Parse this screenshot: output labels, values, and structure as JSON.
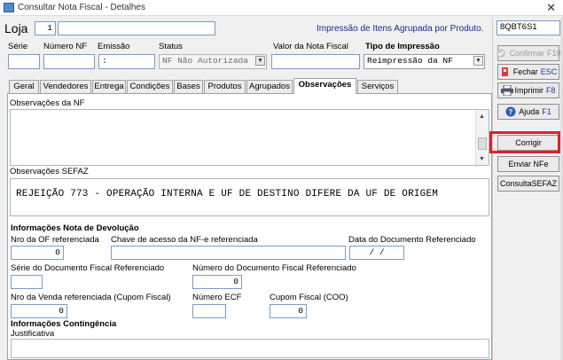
{
  "window": {
    "title": "Consultar Nota Fiscal - Detalhes",
    "close_glyph": "✕"
  },
  "header": {
    "loja_label": "Loja",
    "loja_value": "1",
    "loja_name": "",
    "impressao_text": "Impressão de Itens Agrupada por Produto.",
    "code_value": "8QBT6S1"
  },
  "fields": {
    "serie_label": "Série",
    "numero_nf_label": "Número NF",
    "emissao_label": "Emissão",
    "emissao_value": ":",
    "status_label": "Status",
    "status_value": "NF Não Autorizada",
    "valor_label": "Valor da Nota Fiscal",
    "valor_value": "",
    "tipo_impressao_label": "Tipo de Impressão",
    "tipo_impressao_value": "Reimpressão da NF"
  },
  "tabs": [
    "Geral",
    "Vendedores",
    "Entrega",
    "Condições",
    "Bases",
    "Produtos",
    "Agrupados",
    "Observações",
    "Serviços"
  ],
  "active_tab": "Observações",
  "observacoes": {
    "obs_nf_label": "Observações da NF",
    "obs_sefaz_label": "Observações SEFAZ",
    "obs_sefaz_text": "REJEIÇÃO 773 - OPERAÇÃO INTERNA E UF DE DESTINO DIFERE DA UF DE ORIGEM"
  },
  "devolucao": {
    "section_title": "Informações Nota de Devolução",
    "nro_of_label": "Nro da OF referenciada",
    "nro_of_value": "0",
    "chave_label": "Chave de acesso da NF-e referenciada",
    "chave_value": "",
    "data_doc_label": "Data do Documento Referenciado",
    "data_doc_value": "/ /",
    "serie_doc_label": "Série do Documento Fiscal Referenciado",
    "numero_doc_label": "Número do Documento Fiscal Referenciado",
    "numero_doc_value": "0",
    "nro_venda_label": "Nro da Venda referenciada (Cupom Fiscal)",
    "nro_venda_value": "0",
    "numero_ecf_label": "Número ECF",
    "cupom_label": "Cupom Fiscal (COO)",
    "cupom_value": "0"
  },
  "contingencia": {
    "section_title": "Informações Contingência",
    "justificativa_label": "Justificativa"
  },
  "buttons": {
    "confirmar": {
      "label": "Confirmar",
      "key": "F10"
    },
    "fechar": {
      "label": "Fechar",
      "key": "ESC"
    },
    "imprimir": {
      "label": "Imprimir",
      "key": "F8"
    },
    "ajuda": {
      "label": "Ajuda",
      "key": "F1"
    },
    "corrigir": "Corrigir",
    "enviar_nfe": "Enviar NFe",
    "consulta_sefaz": "ConsultaSEFAZ"
  },
  "colors": {
    "highlight": "#e0202a",
    "accent_text": "#1e2a8c",
    "input_border": "#7a9cc6"
  }
}
